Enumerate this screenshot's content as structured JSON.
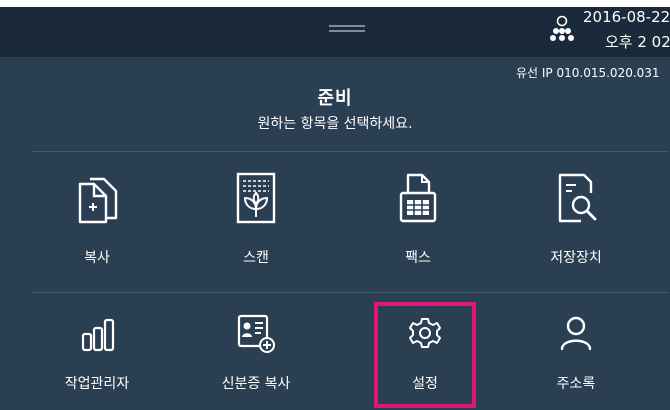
{
  "status_bar": {
    "date": "2016-08-22",
    "time": "오후 2 02",
    "network_icon": "network-nodes-icon",
    "handle_icon": "drag-handle-icon"
  },
  "network": {
    "ip_text": "유선 IP 010.015.020.031"
  },
  "status": {
    "title": "준비",
    "message": "원하는 항목을 선택하세요."
  },
  "menu": {
    "row1": [
      {
        "label": "복사",
        "icon": "copy-icon"
      },
      {
        "label": "스캔",
        "icon": "scan-icon"
      },
      {
        "label": "팩스",
        "icon": "fax-icon"
      },
      {
        "label": "저장장치",
        "icon": "storage-search-icon"
      }
    ],
    "row2": [
      {
        "label": "작업관리자",
        "icon": "job-manager-icon"
      },
      {
        "label": "신분증 복사",
        "icon": "id-card-copy-icon"
      },
      {
        "label": "설정",
        "icon": "gear-icon"
      },
      {
        "label": "주소록",
        "icon": "address-book-icon"
      }
    ]
  },
  "colors": {
    "background": "#2b3f52",
    "top_bar": "#1a2a3a",
    "highlight": "#e0157c",
    "text": "#ffffff"
  }
}
